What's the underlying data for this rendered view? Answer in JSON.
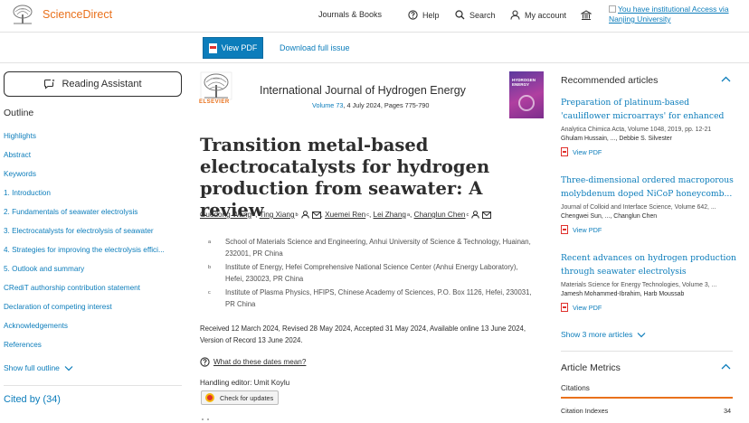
{
  "header": {
    "brand": "ScienceDirect",
    "nav": [
      {
        "label": "Journals & Books",
        "icon": ""
      },
      {
        "label": "Help",
        "icon": "help-circle-icon"
      },
      {
        "label": "Search",
        "icon": "search-icon"
      },
      {
        "label": "My account",
        "icon": "user-icon"
      }
    ],
    "institution_icon": "institution-icon",
    "institutional_access": "You have institutional Access via Nanjing University"
  },
  "toolbar": {
    "view_pdf": "View PDF",
    "download_issue": "Download full issue"
  },
  "sidebar": {
    "reading_assistant": "Reading Assistant",
    "outline_title": "Outline",
    "outline": [
      "Highlights",
      "Abstract",
      "Keywords",
      "1. Introduction",
      "2. Fundamentals of seawater electrolysis",
      "3. Electrocatalysts for electrolysis of seawater",
      "4. Strategies for improving the electrolysis effici...",
      "5. Outlook and summary",
      "CRediT authorship contribution statement",
      "Declaration of competing interest",
      "Acknowledgements",
      "References"
    ],
    "show_full_outline": "Show full outline",
    "cited_by": "Cited by (34)"
  },
  "article": {
    "publisher": "ELSEVIER",
    "journal": "International Journal of Hydrogen Energy",
    "volume": "Volume 73",
    "meta_rest": ", 4 July 2024, Pages 775-790",
    "cover_text": "HYDROGEN ENERGY",
    "title": "Transition metal-based electrocatalysts for hydrogen production from seawater: A review",
    "authors": [
      {
        "name": "Guodong Wang",
        "sup": "a",
        "icons": false
      },
      {
        "name": "Ting Xiang",
        "sup": "b",
        "icons": true
      },
      {
        "name": "Xuemei Ren",
        "sup": "c",
        "icons": false
      },
      {
        "name": "Lei Zhang",
        "sup": "a",
        "icons": false
      },
      {
        "name": "Changlun Chen",
        "sup": "c",
        "icons": true
      }
    ],
    "affiliations": [
      {
        "sup": "a",
        "text": "School of Materials Science and Engineering, Anhui University of Science & Technology, Huainan, 232001, PR China"
      },
      {
        "sup": "b",
        "text": "Institute of Energy, Hefei Comprehensive National Science Center (Anhui Energy Laboratory), Hefei, 230023, PR China"
      },
      {
        "sup": "c",
        "text": "Institute of Plasma Physics, HFIPS, Chinese Academy of Sciences, P.O. Box 1126, Hefei, 230031, PR China"
      }
    ],
    "dates": "Received 12 March 2024, Revised 28 May 2024, Accepted 31 May 2024, Available online 13 June 2024, Version of Record 13 June 2024.",
    "dates_question": "What do these dates mean?",
    "handling_editor": "Handling editor: Umit Koylu",
    "check_updates": "Check for updates"
  },
  "recommended": {
    "title": "Recommended articles",
    "items": [
      {
        "title": "Preparation of platinum-based 'cauliflower microarrays' for enhanced ammonia gas...",
        "source": "Analytica Chimica Acta, Volume 1048, 2019, pp. 12-21",
        "authors": "Ghulam Hussain, ..., Debbie S. Silvester",
        "pdf": "View PDF"
      },
      {
        "title": "Three-dimensional ordered macroporous molybdenum doped NiCoP honeycomb...",
        "source": "Journal of Colloid and Interface Science, Volume 642, ...",
        "authors": "Chengwei Sun, ..., Changlun Chen",
        "pdf": "View PDF"
      },
      {
        "title": "Recent advances on hydrogen production through seawater electrolysis",
        "source": "Materials Science for Energy Technologies, Volume 3, ...",
        "authors": "Jamesh Mohammed-Ibrahim, Harb Moussab",
        "pdf": "View PDF"
      }
    ],
    "show_more": "Show 3 more articles"
  },
  "metrics": {
    "title": "Article Metrics",
    "citations": "Citations",
    "citation_indexes_label": "Citation Indexes",
    "citation_indexes_value": "34"
  },
  "colors": {
    "brand_orange": "#e9711c",
    "link_blue": "#0c7dbb",
    "text": "#2e2e2e"
  }
}
